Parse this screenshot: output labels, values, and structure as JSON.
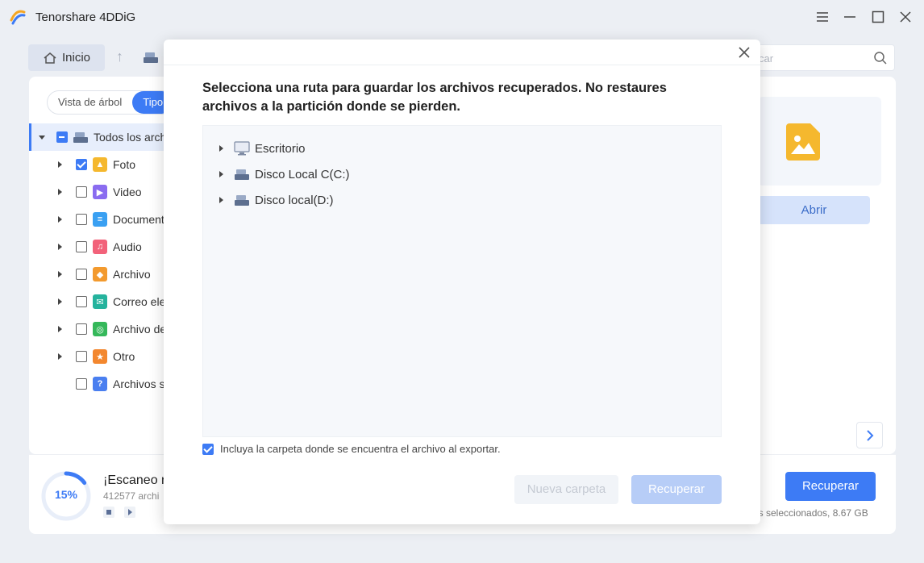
{
  "app": {
    "title": "Tenorshare 4DDiG"
  },
  "toolbar": {
    "home_label": "Inicio",
    "search_placeholder": "car"
  },
  "sidebar": {
    "view_toggle": [
      "Vista de árbol",
      "Tipo"
    ],
    "root_label": "Todos los arch",
    "items": [
      {
        "label": "Foto",
        "checked": true,
        "icon": "photo-icon",
        "color": "#f5b82e"
      },
      {
        "label": "Video",
        "checked": false,
        "icon": "video-icon",
        "color": "#8a6cf0"
      },
      {
        "label": "Document",
        "checked": false,
        "icon": "document-icon",
        "color": "#3aa0f2"
      },
      {
        "label": "Audio",
        "checked": false,
        "icon": "audio-icon",
        "color": "#f2627a"
      },
      {
        "label": "Archivo",
        "checked": false,
        "icon": "archive-icon",
        "color": "#f39a2e"
      },
      {
        "label": "Correo ele",
        "checked": false,
        "icon": "mail-icon",
        "color": "#25b39d"
      },
      {
        "label": "Archivo de",
        "checked": false,
        "icon": "web-icon",
        "color": "#35b85a"
      },
      {
        "label": "Otro",
        "checked": false,
        "icon": "star-icon",
        "color": "#f3872e"
      },
      {
        "label": "Archivos s",
        "checked": false,
        "icon": "question-icon",
        "color": "#4a7ff0"
      }
    ]
  },
  "preview": {
    "open_label": "Abrir"
  },
  "status": {
    "progress_percent": 15,
    "progress_text": "15%",
    "scan_title": "¡Escaneo r",
    "scan_count": "412577 archi",
    "selected_info": "os seleccionados, 8.67 GB",
    "recover_label": "Recuperar"
  },
  "modal": {
    "title": "Selecciona una ruta para guardar los archivos recuperados. No restaures archivos a la partición donde se pierden.",
    "drives": [
      {
        "label": "Escritorio",
        "icon": "desktop-icon"
      },
      {
        "label": "Disco Local C(C:)",
        "icon": "drive-icon"
      },
      {
        "label": "Disco local(D:)",
        "icon": "drive-icon"
      }
    ],
    "include_label": "Incluya la carpeta donde se encuentra el archivo al exportar.",
    "include_checked": true,
    "new_folder_label": "Nueva carpeta",
    "recover_label": "Recuperar"
  },
  "colors": {
    "accent": "#3d7bf5",
    "photo_icon": "#f5b82e"
  }
}
